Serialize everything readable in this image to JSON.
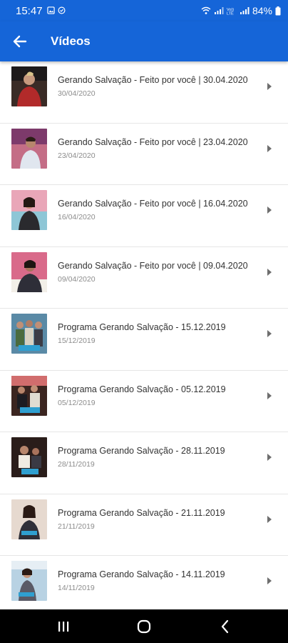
{
  "status_bar": {
    "time": "15:47",
    "battery": "84%"
  },
  "app_bar": {
    "title": "Vídeos",
    "back_icon": "arrow-left-icon"
  },
  "colors": {
    "primary": "#1565d8",
    "title_text": "#333333",
    "date_text": "#8c8c8c"
  },
  "videos": [
    {
      "title": "Gerando Salvação - Feito por você | 30.04.2020",
      "date": "30/04/2020"
    },
    {
      "title": "Gerando Salvação - Feito por você | 23.04.2020",
      "date": "23/04/2020"
    },
    {
      "title": "Gerando Salvação - Feito por você | 16.04.2020",
      "date": "16/04/2020"
    },
    {
      "title": "Gerando Salvação - Feito por você | 09.04.2020",
      "date": "09/04/2020"
    },
    {
      "title": "Programa Gerando Salvação - 15.12.2019",
      "date": "15/12/2019"
    },
    {
      "title": "Programa Gerando Salvação - 05.12.2019",
      "date": "05/12/2019"
    },
    {
      "title": "Programa Gerando Salvação - 28.11.2019",
      "date": "28/11/2019"
    },
    {
      "title": "Programa Gerando Salvação - 21.11.2019",
      "date": "21/11/2019"
    },
    {
      "title": "Programa Gerando Salvação - 14.11.2019",
      "date": "14/11/2019"
    }
  ],
  "nav_bar": {
    "recents_icon": "recents-icon",
    "home_icon": "home-icon",
    "back_icon": "back-icon"
  }
}
